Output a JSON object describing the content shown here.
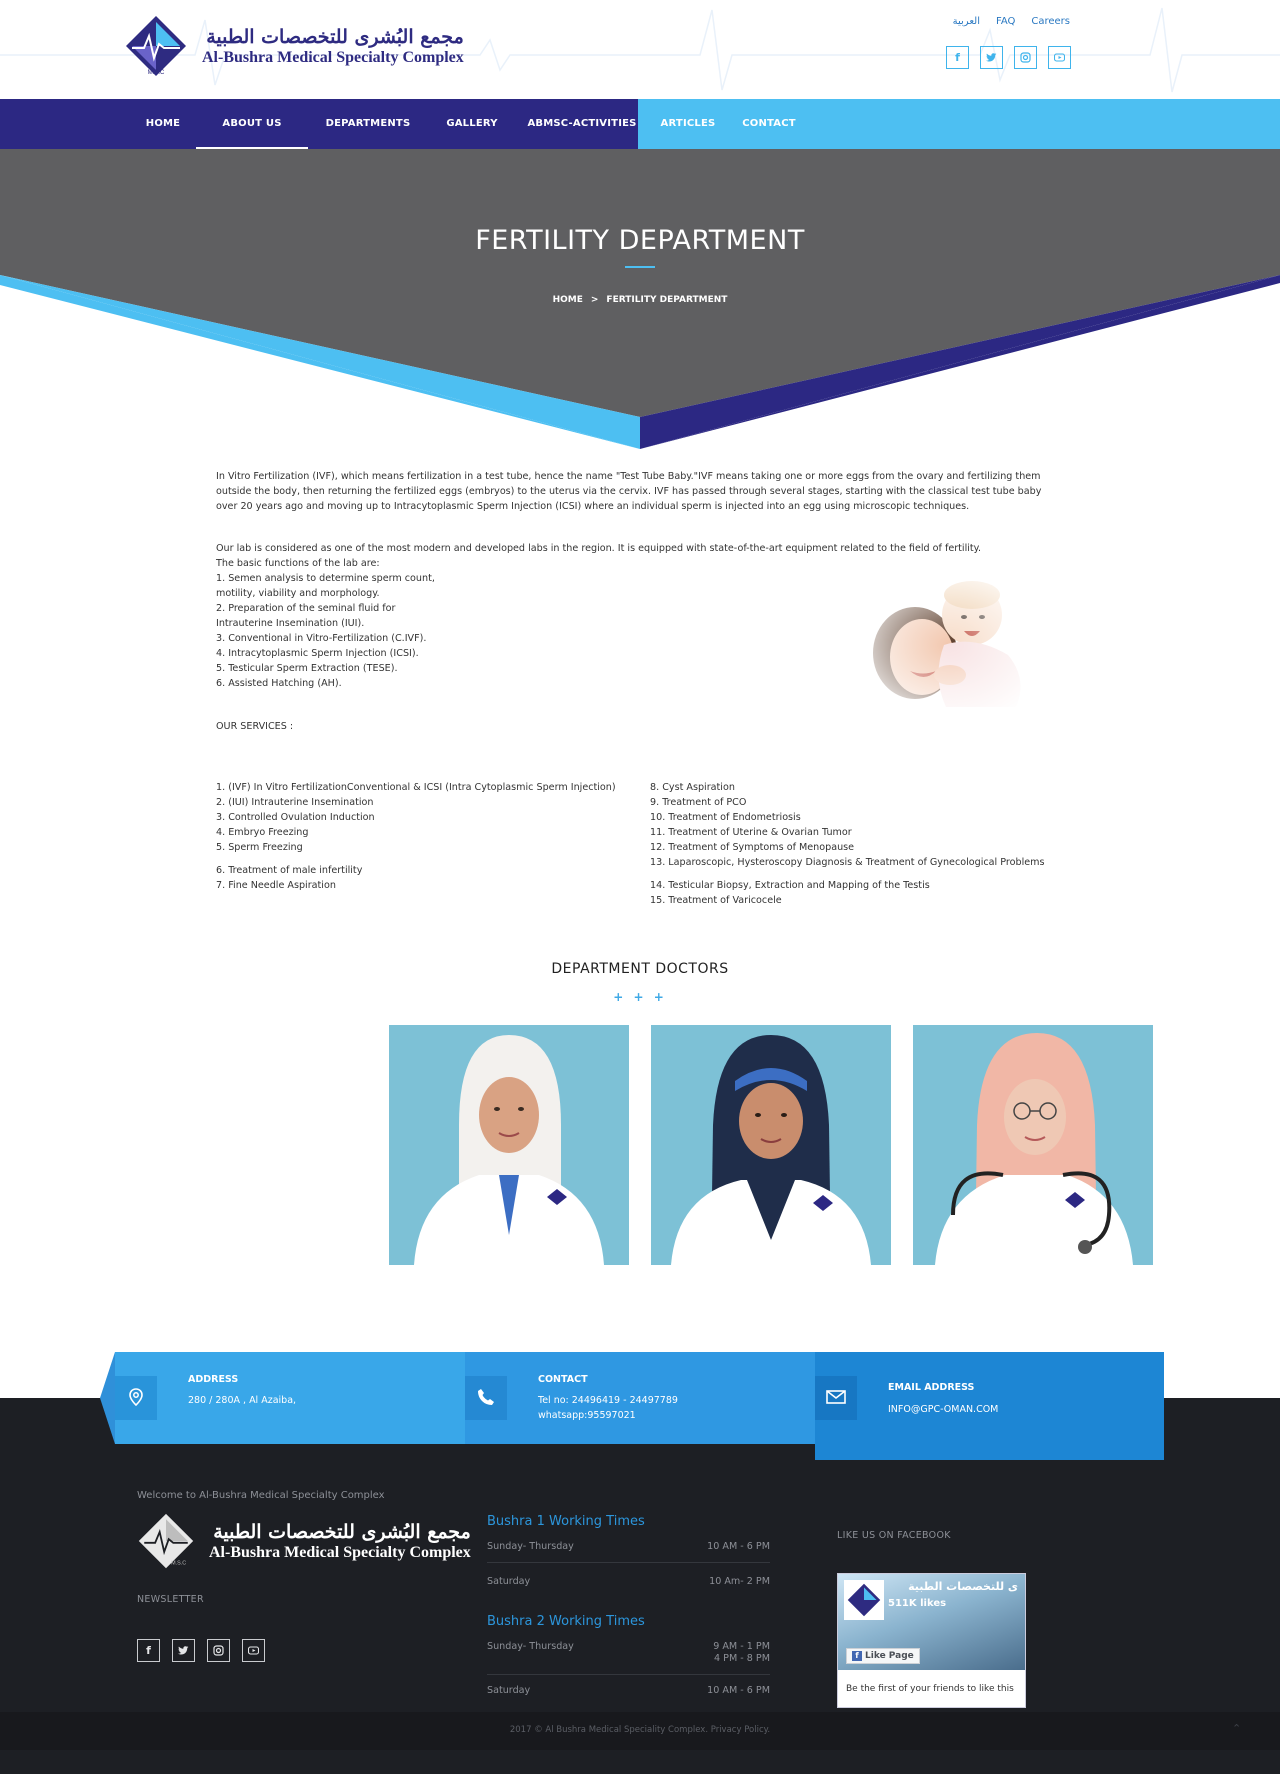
{
  "brand": {
    "name_ar": "مجمع البُشرى للتخصصات الطبية",
    "name_en": "Al-Bushra Medical Specialty Complex",
    "mark": "M.S.C"
  },
  "toplinks": [
    "العربية",
    "FAQ",
    "Careers"
  ],
  "social_icons": [
    "facebook-icon",
    "twitter-icon",
    "instagram-icon",
    "youtube-icon"
  ],
  "nav": {
    "items": [
      "HOME",
      "ABOUT US",
      "DEPARTMENTS",
      "GALLERY",
      "ABMSC-ACTIVITIES",
      "ARTICLES",
      "CONTACT"
    ],
    "active": "ABOUT US"
  },
  "banner": {
    "title": "FERTILITY DEPARTMENT",
    "breadcrumb_home": "HOME",
    "breadcrumb_sep": ">",
    "breadcrumb_current": "FERTILITY DEPARTMENT"
  },
  "content": {
    "intro": "In Vitro Fertilization (IVF), which means fertilization in a test tube, hence the name \"Test Tube Baby.\"IVF means taking one or more eggs from the ovary and fertilizing them outside the body, then returning the fertilized eggs (embryos) to the uterus via the cervix. IVF has passed through several stages, starting with the classical test tube baby over 20 years ago and moving up to Intracytoplasmic Sperm Injection (ICSI) where an individual sperm is injected into an egg using microscopic techniques.",
    "lab_intro": "Our lab is considered as one of the most modern and developed labs in the region. It is equipped with state-of-the-art equipment related to the field of fertility.",
    "lab_functions_title": "The basic functions of the lab are:",
    "lab_functions": [
      "1. Semen analysis to determine sperm count,",
      "motility, viability and morphology.",
      "2. Preparation of the seminal fluid for",
      "Intrauterine Insemination (IUI).",
      "3. Conventional in Vitro-Fertilization (C.IVF).",
      "4. Intracytoplasmic Sperm Injection (ICSI).",
      "5. Testicular Sperm Extraction (TESE).",
      "6. Assisted Hatching (AH)."
    ],
    "services_title": "OUR SERVICES :",
    "services_left": [
      "1. (IVF) In Vitro FertilizationConventional & ICSI (Intra Cytoplasmic Sperm Injection)",
      "2. (IUI) Intrauterine Insemination",
      "3. Controlled Ovulation Induction",
      "4. Embryo Freezing",
      "5. Sperm Freezing",
      "6. Treatment of male infertility",
      "7. Fine Needle Aspiration"
    ],
    "services_right": [
      "8. Cyst Aspiration",
      "9. Treatment of PCO",
      "10. Treatment of Endometriosis",
      "11. Treatment of Uterine & Ovarian Tumor",
      "12. Treatment of Symptoms of Menopause",
      "13. Laparoscopic, Hysteroscopy Diagnosis & Treatment of Gynecological Problems",
      "14. Testicular Biopsy, Extraction and Mapping of the Testis",
      "15. Treatment of Varicocele"
    ]
  },
  "doctors": {
    "title": "DEPARTMENT DOCTORS",
    "ornament": "+ + +",
    "photos": [
      {
        "hijab": "#f3f1ee",
        "skin": "#d9a283"
      },
      {
        "hijab": "#1f2d4a",
        "skin": "#c98d6d"
      },
      {
        "hijab": "#f1b7a6",
        "skin": "#efc8b4"
      }
    ]
  },
  "contact": {
    "address_label": "ADDRESS",
    "address_value": "280 / 280A , Al Azaiba,",
    "contact_label": "CONTACT",
    "contact_tel": "Tel no: 24496419 - 24497789",
    "contact_whatsapp": "whatsapp:95597021",
    "email_label": "EMAIL ADDRESS",
    "email_value": "INFO@GPC-OMAN.COM"
  },
  "footer": {
    "welcome": "Welcome to Al-Bushra Medical Specialty Complex",
    "newsletter": "NEWSLETTER",
    "hours": [
      {
        "title": "Bushra 1 Working Times",
        "rows": [
          {
            "day": "Sunday- Thursday",
            "time": "10 AM - 6 PM"
          },
          {
            "day": "Saturday",
            "time": "10 Am- 2 PM"
          }
        ]
      },
      {
        "title": "Bushra 2 Working Times",
        "rows": [
          {
            "day": "Sunday- Thursday",
            "time": "9 AM - 1 PM",
            "time2": "4 PM - 8 PM"
          },
          {
            "day": "Saturday",
            "time": "10 AM - 6 PM"
          }
        ]
      }
    ],
    "facebook_title": "LIKE US ON FACEBOOK",
    "fb_page_name": "ى للتخصصات الطبية",
    "fb_likes": "511K likes",
    "fb_like_button": "Like Page",
    "fb_friends": "Be the first of your friends to like this",
    "copyright": "2017 © Al Bushra Medical Speciality Complex. Privacy Policy."
  },
  "colors": {
    "navy": "#2c2883",
    "sky": "#4dbff2",
    "banner_gray": "#5f5f61",
    "footer_dark": "#1d1f24"
  }
}
